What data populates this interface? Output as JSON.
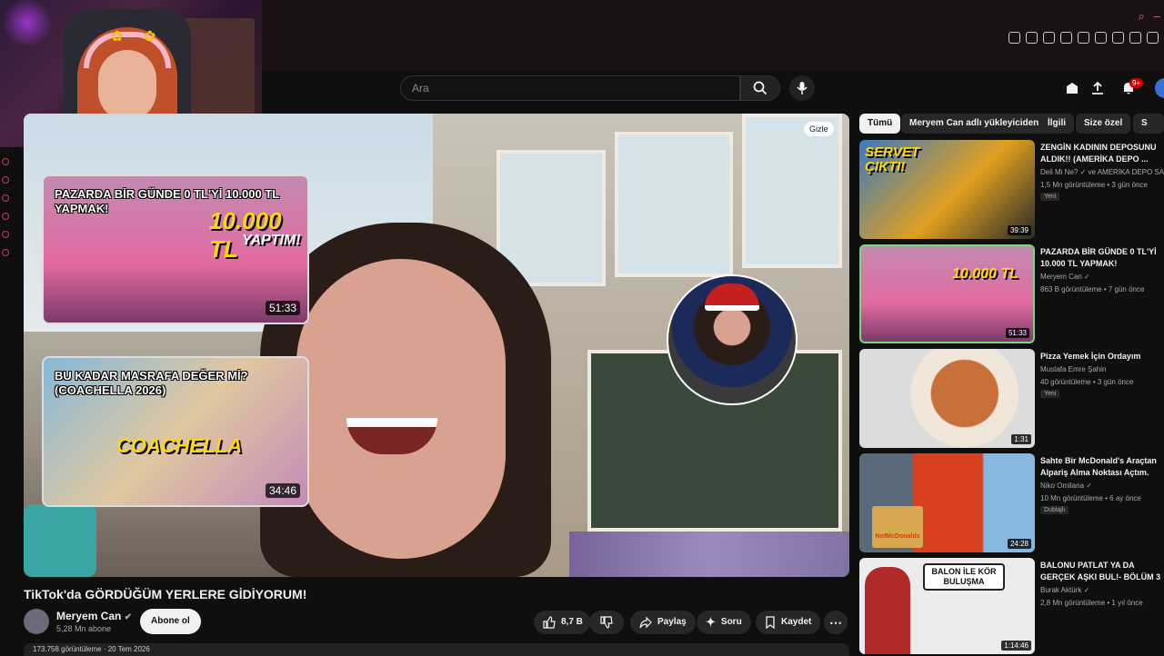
{
  "search": {
    "placeholder": "Ara"
  },
  "header": {
    "notification_count": "9+"
  },
  "player": {
    "hide_label": "Gizle"
  },
  "end_cards": [
    {
      "title": "PAZARDA BİR GÜNDE 0 TL'Yİ 10.000 TL YAPMAK!",
      "duration": "51:33",
      "overlay": "10.000 TL",
      "overlay2": "YAPTIM!"
    },
    {
      "title": "BU KADAR MASRAFA DEĞER Mİ? (COACHELLA 2026)",
      "duration": "34:46",
      "overlay": "COACHELLA"
    }
  ],
  "video": {
    "title": "TikTok'da GÖRDÜĞÜM YERLERE GİDİYORUM!",
    "channel": "Meryem Can",
    "subscribers": "5,28 Mn abone",
    "subscribe_label": "Abone ol",
    "likes": "8,7 B",
    "share_label": "Paylaş",
    "ask_label": "Soru",
    "save_label": "Kaydet",
    "more": "⋯",
    "description_peek": "173.758 görüntüleme · 20 Tem 2026"
  },
  "chips": [
    "Tümü",
    "Meryem Can adlı yükleyiciden",
    "İlgili",
    "Size özel",
    "S"
  ],
  "recommendations": [
    {
      "title": "ZENGİN KADININ DEPOSUNU ALDIK!! (AMERİKA DEPO ...",
      "channel": "Deli Mi Ne? ✓ ve AMERİKA DEPO SA",
      "views": "1,5 Mn görüntüleme • 3 gün önce",
      "badge": "Yeni",
      "duration": "39:39",
      "thumb_text": "SERVET ÇIKTI!",
      "color": "#3a7ac0"
    },
    {
      "title": "PAZARDA BİR GÜNDE 0 TL'Yİ 10.000 TL YAPMAK!",
      "channel": "Meryem Can ✓",
      "views": "863 B görüntüleme • 7 gün önce",
      "badge": "",
      "duration": "51:33",
      "thumb_text": "10.000 TL",
      "color": "#d0609a"
    },
    {
      "title": "Pizza Yemek İçin Ordayım",
      "channel": "Mustafa Emre Şahin",
      "views": "40 görüntüleme • 3 gün önce",
      "badge": "Yeni",
      "duration": "1:31",
      "thumb_text": "",
      "color": "#c89070"
    },
    {
      "title": "Sahte Bir McDonald's Araçtan Alpariş Alma Noktası Açtım.",
      "channel": "Niko Omilana ✓",
      "views": "10 Mn görüntüleme • 6 ay önce",
      "badge": "Dublajlı",
      "duration": "24:28",
      "thumb_text": "NotMcDonalds",
      "color": "#c03020"
    },
    {
      "title": "BALONU PATLAT YA DA GERÇEK AŞKI BUL!- BÖLÜM 3",
      "channel": "Burak Aktürk ✓",
      "views": "2,8 Mn görüntüleme • 1 yıl önce",
      "badge": "",
      "duration": "1:14:46",
      "thumb_text": "BALON İLE KÖR BULUŞMA",
      "color": "#e8e8e8"
    }
  ]
}
